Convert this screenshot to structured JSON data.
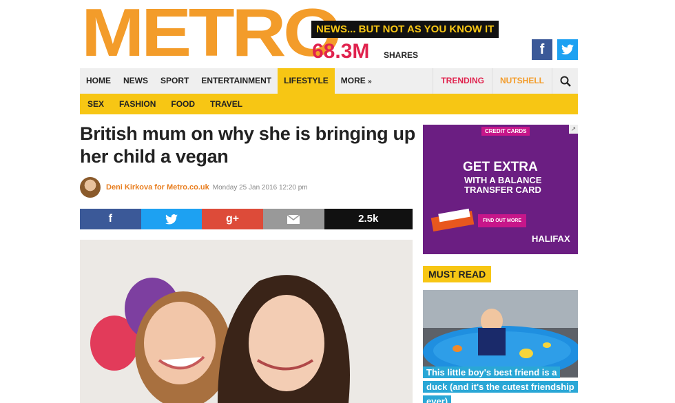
{
  "brand": {
    "logo": "METRO",
    "tagline": "NEWS... BUT NOT AS YOU KNOW IT",
    "shares_count": "68.3M",
    "shares_label": "SHARES"
  },
  "header_social": {
    "facebook": "f",
    "twitter": "t"
  },
  "nav": {
    "items": [
      "HOME",
      "NEWS",
      "SPORT",
      "ENTERTAINMENT",
      "LIFESTYLE",
      "MORE"
    ],
    "active": "LIFESTYLE",
    "trending": "TRENDING",
    "nutshell": "NUTSHELL",
    "search_icon": "search-icon"
  },
  "subnav": {
    "items": [
      "SEX",
      "FASHION",
      "FOOD",
      "TRAVEL"
    ]
  },
  "article": {
    "headline": "British mum on why she is bringing up her child a vegan",
    "author": "Deni Kirkova for Metro.co.uk",
    "date": "Monday 25 Jan 2016 12:20 pm",
    "share": {
      "facebook": "f",
      "twitter": "t",
      "googleplus": "g+",
      "email": "email-icon",
      "count": "2.5k"
    }
  },
  "ad": {
    "tag": "CREDIT CARDS",
    "headline": "GET EXTRA",
    "subline": "WITH A BALANCE TRANSFER CARD",
    "cta": "FIND OUT MORE",
    "brand": "HALIFAX"
  },
  "must_read": {
    "label": "MUST READ",
    "caption": "This little boy's best friend is a duck (and it's the cutest friendship ever)"
  },
  "colors": {
    "brand_orange": "#f39c2a",
    "brand_yellow": "#f7c614",
    "trending_red": "#e0234e"
  }
}
